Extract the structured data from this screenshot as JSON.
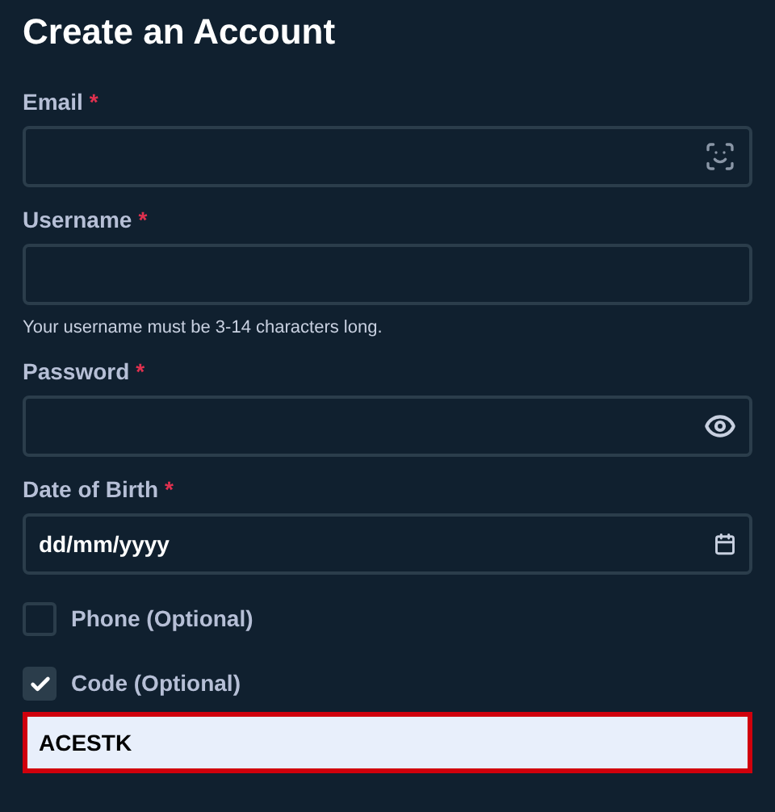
{
  "title": "Create an Account",
  "fields": [
    {
      "label": "Email",
      "required": true,
      "kind": "email"
    },
    {
      "label": "Username",
      "required": true,
      "kind": "text",
      "hint": "Your username must be 3-14 characters long."
    },
    {
      "label": "Password",
      "required": true,
      "kind": "password"
    },
    {
      "label": "Date of Birth",
      "required": true,
      "kind": "date",
      "value": "dd/mm/yyyy"
    }
  ],
  "options": [
    {
      "label": "Phone (Optional)",
      "checked": false
    },
    {
      "label": "Code (Optional)",
      "checked": true,
      "field": {
        "value": "ACESTK",
        "invalid": true
      }
    }
  ],
  "required_mark": "*"
}
